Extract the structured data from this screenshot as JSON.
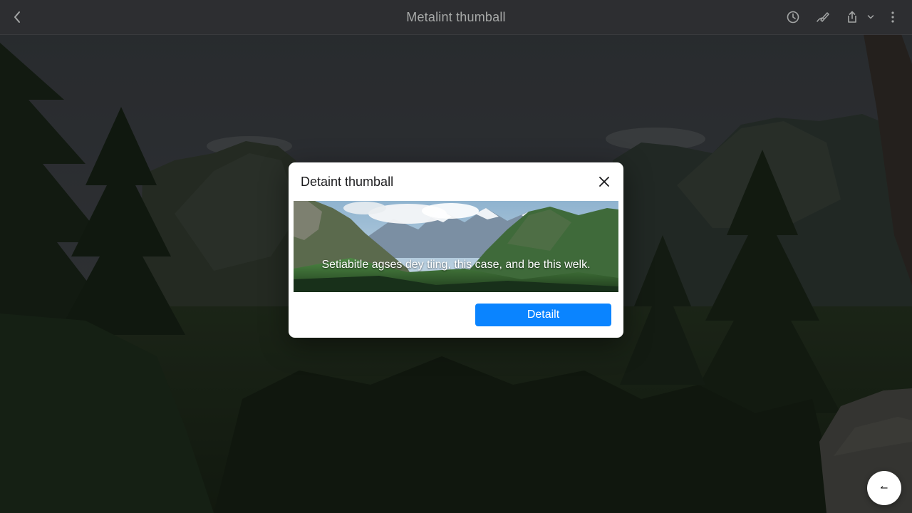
{
  "window": {
    "title": "Metalint thumball"
  },
  "toolbar": {
    "back_icon": "chevron-left-icon",
    "icons": [
      "history-icon",
      "markup-pen-icon",
      "share-icon",
      "chevron-down-icon",
      "more-vertical-icon"
    ]
  },
  "dialog": {
    "title": "Detaint thumball",
    "close_icon": "close-icon",
    "thumbnail_caption": "Setiabitle agses dey tiing, this case, and be this welk.",
    "primary_button_label": "Detailt"
  },
  "fab": {
    "icon": "compact-glyph-icon",
    "glyph": "↼"
  },
  "colors": {
    "accent": "#0a84ff",
    "topbar": "#2e3032",
    "title_text": "#a7a9a8",
    "dialog_bg": "#ffffff"
  }
}
